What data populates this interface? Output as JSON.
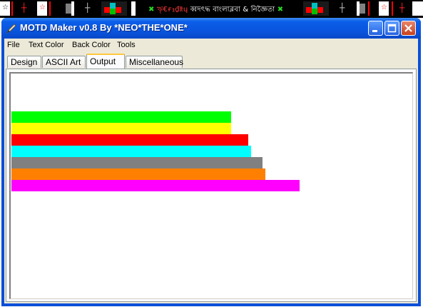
{
  "top_strip": {
    "text_red_1": "ৠ€ғⲝ₫₶ɥ",
    "text": "ব্বদৎদ্ধ বাংলাব্লবা & নিজ্ঞৈতা",
    "marks": [
      "☆",
      "┼",
      "☆",
      "┼",
      "┼",
      "✖",
      "✖",
      "┼",
      "☆",
      "┼"
    ]
  },
  "window": {
    "title": "MOTD Maker v0.8 By *NEO*THE*ONE*",
    "controls": [
      "minimize",
      "maximize",
      "close"
    ]
  },
  "menu": [
    "File",
    "Text Color",
    "Back Color",
    "Tools"
  ],
  "tabs": [
    {
      "label": "Design",
      "active": false
    },
    {
      "label": "ASCII Art",
      "active": false
    },
    {
      "label": "Output",
      "active": true
    },
    {
      "label": "Miscellaneous",
      "active": false
    }
  ],
  "output": {
    "color_bars": [
      {
        "color": "#00ff00"
      },
      {
        "color": "#ffff00"
      },
      {
        "color": "#ff0000"
      },
      {
        "color": "#00ffff"
      },
      {
        "color": "#808080"
      },
      {
        "color": "#ff8000"
      },
      {
        "color": "#ff00ff"
      }
    ]
  }
}
